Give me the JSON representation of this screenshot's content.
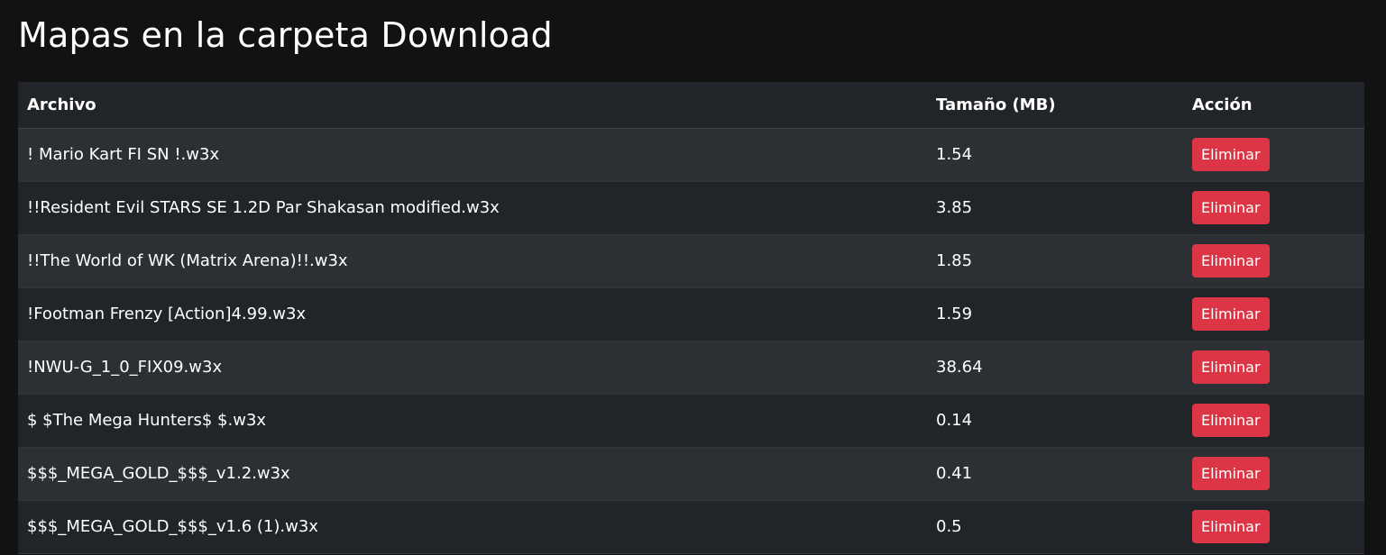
{
  "page": {
    "title": "Mapas en la carpeta Download"
  },
  "table": {
    "headers": {
      "file": "Archivo",
      "size": "Tamaño (MB)",
      "action": "Acción"
    },
    "rows": [
      {
        "file": "! Mario Kart FI SN !.w3x",
        "size": "1.54",
        "action": "Eliminar"
      },
      {
        "file": "!!Resident Evil STARS SE 1.2D Par Shakasan modified.w3x",
        "size": "3.85",
        "action": "Eliminar"
      },
      {
        "file": "!!The World of WK (Matrix Arena)!!.w3x",
        "size": "1.85",
        "action": "Eliminar"
      },
      {
        "file": "!Footman Frenzy [Action]4.99.w3x",
        "size": "1.59",
        "action": "Eliminar"
      },
      {
        "file": "!NWU-G_1_0_FIX09.w3x",
        "size": "38.64",
        "action": "Eliminar"
      },
      {
        "file": "$ $The Mega Hunters$ $.w3x",
        "size": "0.14",
        "action": "Eliminar"
      },
      {
        "file": "$$$_MEGA_GOLD_$$$_v1.2.w3x",
        "size": "0.41",
        "action": "Eliminar"
      },
      {
        "file": "$$$_MEGA_GOLD_$$$_v1.6 (1).w3x",
        "size": "0.5",
        "action": "Eliminar"
      }
    ]
  },
  "colors": {
    "page_background": "#121212",
    "row_odd": "#2c3034",
    "row_even": "#212529",
    "danger_button": "#dc3545"
  }
}
